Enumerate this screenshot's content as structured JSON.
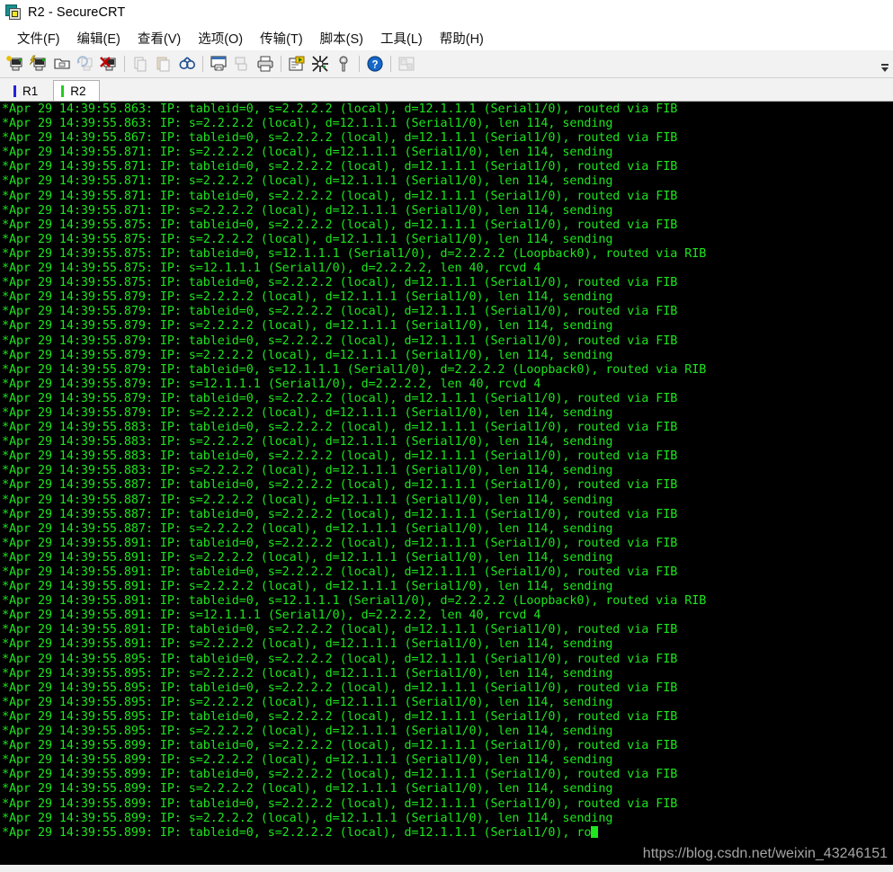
{
  "window": {
    "title": "R2 - SecureCRT",
    "icon": "securecrt-app-icon"
  },
  "menu": {
    "items": [
      {
        "label": "文件(F)",
        "name": "menu-file"
      },
      {
        "label": "编辑(E)",
        "name": "menu-edit"
      },
      {
        "label": "查看(V)",
        "name": "menu-view"
      },
      {
        "label": "选项(O)",
        "name": "menu-options"
      },
      {
        "label": "传输(T)",
        "name": "menu-transfer"
      },
      {
        "label": "脚本(S)",
        "name": "menu-script"
      },
      {
        "label": "工具(L)",
        "name": "menu-tools"
      },
      {
        "label": "帮助(H)",
        "name": "menu-help"
      }
    ]
  },
  "toolbar": {
    "buttons": [
      {
        "name": "new-session-icon",
        "glyph": "✶"
      },
      {
        "name": "quick-connect-icon",
        "glyph": "⚡"
      },
      {
        "name": "connect-in-tab-icon",
        "glyph": "▭"
      },
      {
        "name": "reconnect-icon",
        "glyph": "↺"
      },
      {
        "name": "disconnect-icon",
        "glyph": "✗"
      },
      {
        "name": "separator-1",
        "glyph": "|"
      },
      {
        "name": "copy-icon",
        "glyph": "⧉"
      },
      {
        "name": "paste-icon",
        "glyph": "📋"
      },
      {
        "name": "find-icon",
        "glyph": "🔍"
      },
      {
        "name": "separator-2",
        "glyph": "|"
      },
      {
        "name": "print-screen-icon",
        "glyph": "🖶"
      },
      {
        "name": "log-session-icon",
        "glyph": "🗒"
      },
      {
        "name": "print-icon",
        "glyph": "🖨"
      },
      {
        "name": "separator-3",
        "glyph": "|"
      },
      {
        "name": "session-options-icon",
        "glyph": "⚙"
      },
      {
        "name": "global-options-icon",
        "glyph": "✦"
      },
      {
        "name": "key-icon",
        "glyph": "🗝"
      },
      {
        "name": "separator-4",
        "glyph": "|"
      },
      {
        "name": "help-icon",
        "glyph": "?"
      },
      {
        "name": "separator-5",
        "glyph": "|"
      },
      {
        "name": "session-manager-icon",
        "glyph": "▤"
      }
    ],
    "overflow_label": "⏷"
  },
  "tabs": {
    "items": [
      {
        "label": "R1",
        "name": "tab-r1",
        "active": false,
        "marker_color": "#2222dd"
      },
      {
        "label": "R2",
        "name": "tab-r2",
        "active": true,
        "marker_color": "#22cc22"
      }
    ]
  },
  "terminal": {
    "colors": {
      "background": "#000000",
      "foreground": "#1ee51e",
      "cursor": "#1ee51e"
    },
    "lines": [
      "*Apr 29 14:39:55.863: IP: tableid=0, s=2.2.2.2 (local), d=12.1.1.1 (Serial1/0), routed via FIB",
      "*Apr 29 14:39:55.863: IP: s=2.2.2.2 (local), d=12.1.1.1 (Serial1/0), len 114, sending",
      "*Apr 29 14:39:55.867: IP: tableid=0, s=2.2.2.2 (local), d=12.1.1.1 (Serial1/0), routed via FIB",
      "*Apr 29 14:39:55.871: IP: s=2.2.2.2 (local), d=12.1.1.1 (Serial1/0), len 114, sending",
      "*Apr 29 14:39:55.871: IP: tableid=0, s=2.2.2.2 (local), d=12.1.1.1 (Serial1/0), routed via FIB",
      "*Apr 29 14:39:55.871: IP: s=2.2.2.2 (local), d=12.1.1.1 (Serial1/0), len 114, sending",
      "*Apr 29 14:39:55.871: IP: tableid=0, s=2.2.2.2 (local), d=12.1.1.1 (Serial1/0), routed via FIB",
      "*Apr 29 14:39:55.871: IP: s=2.2.2.2 (local), d=12.1.1.1 (Serial1/0), len 114, sending",
      "*Apr 29 14:39:55.875: IP: tableid=0, s=2.2.2.2 (local), d=12.1.1.1 (Serial1/0), routed via FIB",
      "*Apr 29 14:39:55.875: IP: s=2.2.2.2 (local), d=12.1.1.1 (Serial1/0), len 114, sending",
      "*Apr 29 14:39:55.875: IP: tableid=0, s=12.1.1.1 (Serial1/0), d=2.2.2.2 (Loopback0), routed via RIB",
      "*Apr 29 14:39:55.875: IP: s=12.1.1.1 (Serial1/0), d=2.2.2.2, len 40, rcvd 4",
      "*Apr 29 14:39:55.875: IP: tableid=0, s=2.2.2.2 (local), d=12.1.1.1 (Serial1/0), routed via FIB",
      "*Apr 29 14:39:55.879: IP: s=2.2.2.2 (local), d=12.1.1.1 (Serial1/0), len 114, sending",
      "*Apr 29 14:39:55.879: IP: tableid=0, s=2.2.2.2 (local), d=12.1.1.1 (Serial1/0), routed via FIB",
      "*Apr 29 14:39:55.879: IP: s=2.2.2.2 (local), d=12.1.1.1 (Serial1/0), len 114, sending",
      "*Apr 29 14:39:55.879: IP: tableid=0, s=2.2.2.2 (local), d=12.1.1.1 (Serial1/0), routed via FIB",
      "*Apr 29 14:39:55.879: IP: s=2.2.2.2 (local), d=12.1.1.1 (Serial1/0), len 114, sending",
      "*Apr 29 14:39:55.879: IP: tableid=0, s=12.1.1.1 (Serial1/0), d=2.2.2.2 (Loopback0), routed via RIB",
      "*Apr 29 14:39:55.879: IP: s=12.1.1.1 (Serial1/0), d=2.2.2.2, len 40, rcvd 4",
      "*Apr 29 14:39:55.879: IP: tableid=0, s=2.2.2.2 (local), d=12.1.1.1 (Serial1/0), routed via FIB",
      "*Apr 29 14:39:55.879: IP: s=2.2.2.2 (local), d=12.1.1.1 (Serial1/0), len 114, sending",
      "*Apr 29 14:39:55.883: IP: tableid=0, s=2.2.2.2 (local), d=12.1.1.1 (Serial1/0), routed via FIB",
      "*Apr 29 14:39:55.883: IP: s=2.2.2.2 (local), d=12.1.1.1 (Serial1/0), len 114, sending",
      "*Apr 29 14:39:55.883: IP: tableid=0, s=2.2.2.2 (local), d=12.1.1.1 (Serial1/0), routed via FIB",
      "*Apr 29 14:39:55.883: IP: s=2.2.2.2 (local), d=12.1.1.1 (Serial1/0), len 114, sending",
      "*Apr 29 14:39:55.887: IP: tableid=0, s=2.2.2.2 (local), d=12.1.1.1 (Serial1/0), routed via FIB",
      "*Apr 29 14:39:55.887: IP: s=2.2.2.2 (local), d=12.1.1.1 (Serial1/0), len 114, sending",
      "*Apr 29 14:39:55.887: IP: tableid=0, s=2.2.2.2 (local), d=12.1.1.1 (Serial1/0), routed via FIB",
      "*Apr 29 14:39:55.887: IP: s=2.2.2.2 (local), d=12.1.1.1 (Serial1/0), len 114, sending",
      "*Apr 29 14:39:55.891: IP: tableid=0, s=2.2.2.2 (local), d=12.1.1.1 (Serial1/0), routed via FIB",
      "*Apr 29 14:39:55.891: IP: s=2.2.2.2 (local), d=12.1.1.1 (Serial1/0), len 114, sending",
      "*Apr 29 14:39:55.891: IP: tableid=0, s=2.2.2.2 (local), d=12.1.1.1 (Serial1/0), routed via FIB",
      "*Apr 29 14:39:55.891: IP: s=2.2.2.2 (local), d=12.1.1.1 (Serial1/0), len 114, sending",
      "*Apr 29 14:39:55.891: IP: tableid=0, s=12.1.1.1 (Serial1/0), d=2.2.2.2 (Loopback0), routed via RIB",
      "*Apr 29 14:39:55.891: IP: s=12.1.1.1 (Serial1/0), d=2.2.2.2, len 40, rcvd 4",
      "*Apr 29 14:39:55.891: IP: tableid=0, s=2.2.2.2 (local), d=12.1.1.1 (Serial1/0), routed via FIB",
      "*Apr 29 14:39:55.891: IP: s=2.2.2.2 (local), d=12.1.1.1 (Serial1/0), len 114, sending",
      "*Apr 29 14:39:55.895: IP: tableid=0, s=2.2.2.2 (local), d=12.1.1.1 (Serial1/0), routed via FIB",
      "*Apr 29 14:39:55.895: IP: s=2.2.2.2 (local), d=12.1.1.1 (Serial1/0), len 114, sending",
      "*Apr 29 14:39:55.895: IP: tableid=0, s=2.2.2.2 (local), d=12.1.1.1 (Serial1/0), routed via FIB",
      "*Apr 29 14:39:55.895: IP: s=2.2.2.2 (local), d=12.1.1.1 (Serial1/0), len 114, sending",
      "*Apr 29 14:39:55.895: IP: tableid=0, s=2.2.2.2 (local), d=12.1.1.1 (Serial1/0), routed via FIB",
      "*Apr 29 14:39:55.895: IP: s=2.2.2.2 (local), d=12.1.1.1 (Serial1/0), len 114, sending",
      "*Apr 29 14:39:55.899: IP: tableid=0, s=2.2.2.2 (local), d=12.1.1.1 (Serial1/0), routed via FIB",
      "*Apr 29 14:39:55.899: IP: s=2.2.2.2 (local), d=12.1.1.1 (Serial1/0), len 114, sending",
      "*Apr 29 14:39:55.899: IP: tableid=0, s=2.2.2.2 (local), d=12.1.1.1 (Serial1/0), routed via FIB",
      "*Apr 29 14:39:55.899: IP: s=2.2.2.2 (local), d=12.1.1.1 (Serial1/0), len 114, sending",
      "*Apr 29 14:39:55.899: IP: tableid=0, s=2.2.2.2 (local), d=12.1.1.1 (Serial1/0), routed via FIB",
      "*Apr 29 14:39:55.899: IP: s=2.2.2.2 (local), d=12.1.1.1 (Serial1/0), len 114, sending"
    ],
    "last_line_partial": "*Apr 29 14:39:55.899: IP: tableid=0, s=2.2.2.2 (local), d=12.1.1.1 (Serial1/0), ro"
  },
  "watermark": {
    "text": "https://blog.csdn.net/weixin_43246151"
  }
}
